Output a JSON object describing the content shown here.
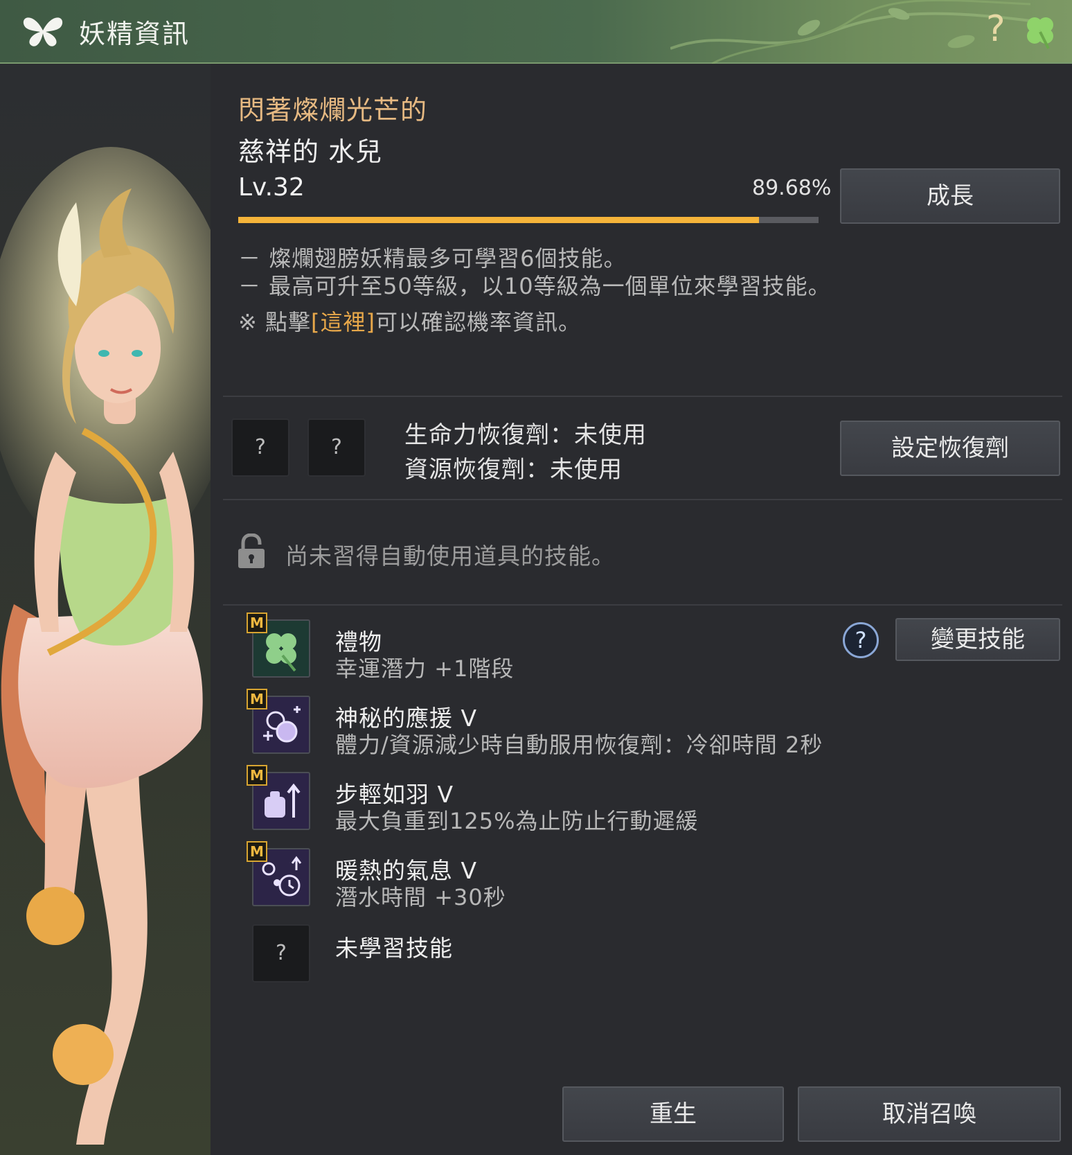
{
  "window": {
    "title": "妖精資訊",
    "help_label": "?",
    "title_icon": "butterfly-icon",
    "clover_icon": "clover-icon"
  },
  "fairy": {
    "rarity": "閃著燦爛光芒的",
    "name": "慈祥的 水兒",
    "level": "Lv.32",
    "progress_text": "89.68%",
    "progress_value": 0.8968,
    "grow_label": "成長"
  },
  "info": {
    "line1": "－ 燦爛翅膀妖精最多可學習6個技能。",
    "line2": "－ 最高可升至50等級，以10等級為一個單位來學習技能。",
    "line3_prefix": "※ 點擊",
    "line3_link": "[這裡]",
    "line3_suffix": "可以確認機率資訊。"
  },
  "potions": {
    "slot1": "?",
    "slot2": "?",
    "hp_text": "生命力恢復劑：未使用",
    "resource_text": "資源恢復劑：未使用",
    "set_label": "設定恢復劑"
  },
  "auto_item": {
    "locked_text": "尚未習得自動使用道具的技能。",
    "lock_icon": "lock-icon"
  },
  "skills": {
    "help_label": "?",
    "change_label": "變更技能",
    "badge": "M",
    "items": [
      {
        "name": "禮物",
        "desc": "幸運潛力 +1階段",
        "icon": "clover-icon"
      },
      {
        "name": "神秘的應援 V",
        "desc": "體力/資源減少時自動服用恢復劑：冷卻時間 2秒",
        "icon": "potion-icon"
      },
      {
        "name": "步輕如羽 V",
        "desc": "最大負重到125%為止防止行動遲緩",
        "icon": "weight-icon"
      },
      {
        "name": "暖熱的氣息 V",
        "desc": "潛水時間 +30秒",
        "icon": "bubble-timer-icon"
      },
      {
        "name": "未學習技能",
        "desc": "",
        "icon": "?"
      }
    ]
  },
  "footer": {
    "rebirth_label": "重生",
    "unsummon_label": "取消召喚"
  },
  "colors": {
    "accent": "#f5b43a",
    "rarity": "#e6b982",
    "titlebar": "#4b6a4e"
  }
}
